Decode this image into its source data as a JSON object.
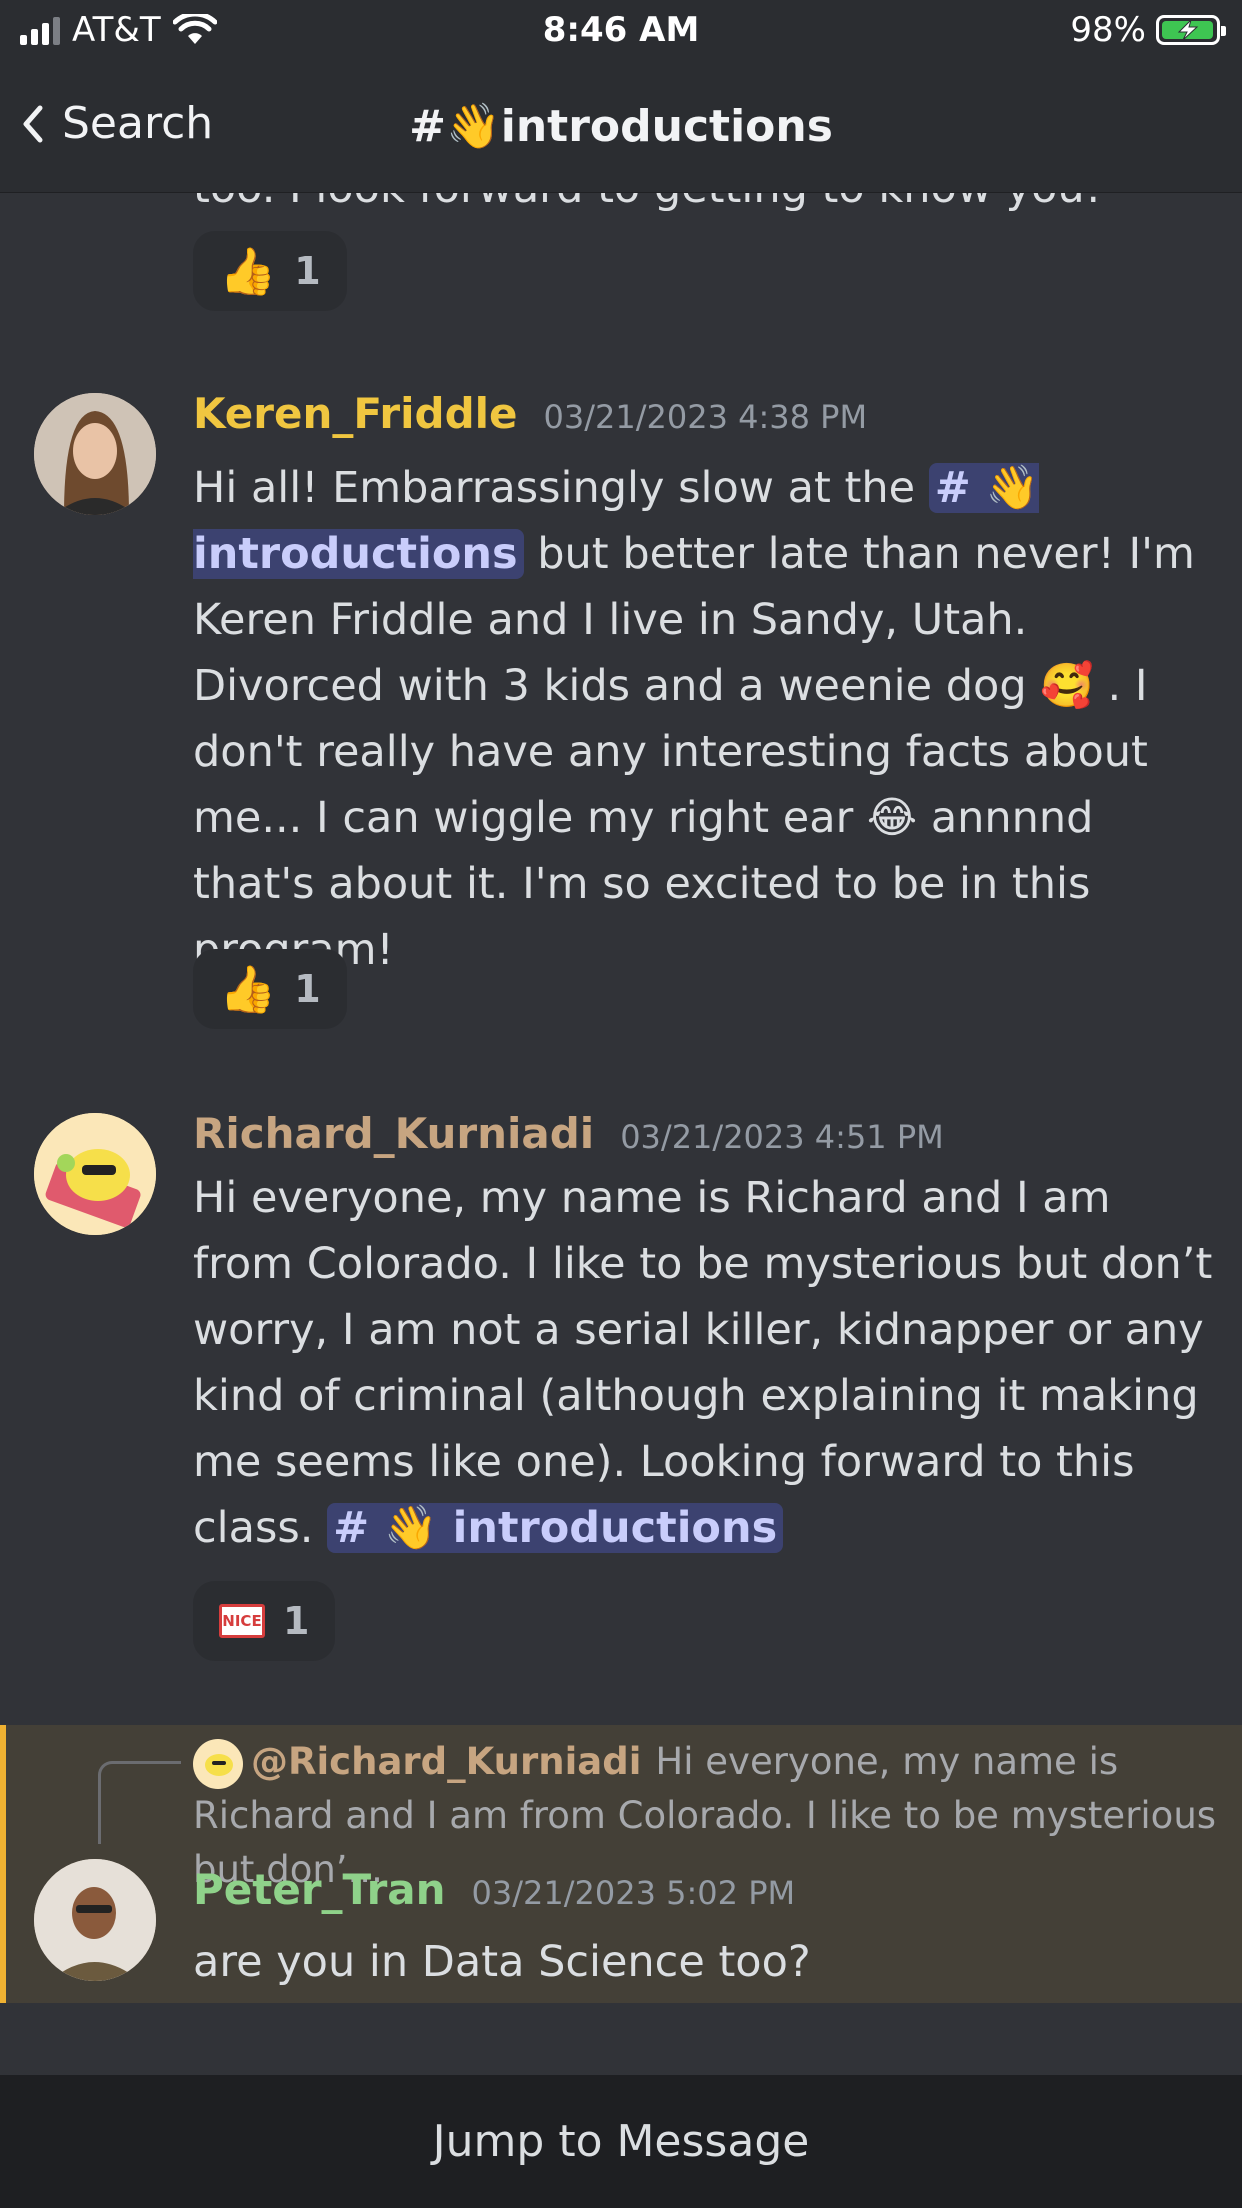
{
  "status_bar": {
    "carrier": "AT&T",
    "time": "8:46 AM",
    "battery": "98%"
  },
  "header": {
    "back_label": "Search",
    "channel": "#👋introductions"
  },
  "messages": [
    {
      "clipped_text": "too. I look forward to getting to know you!",
      "reaction": {
        "emoji": "👍",
        "count": "1"
      }
    },
    {
      "author": "Keren_Friddle",
      "author_color": "#f0c640",
      "timestamp": "03/21/2023 4:38 PM",
      "body": {
        "part1": "Hi all! Embarrassingly slow at the ",
        "mention": "# 👋 introductions",
        "part2": " but better late than never! I'm Keren Friddle and I live in Sandy, Utah. Divorced with 3 kids and a weenie dog 🥰 . I don't really have any interesting facts about me... I can wiggle my right ear 😂 annnnd that's about it. I'm so excited to be in this program!"
      },
      "reaction": {
        "emoji": "👍",
        "count": "1"
      }
    },
    {
      "author": "Richard_Kurniadi",
      "author_color": "#c7a581",
      "timestamp": "03/21/2023 4:51 PM",
      "body": {
        "part1": "Hi everyone, my name is Richard and I am from Colorado. I like to be mysterious but don’t worry, I am not a serial killer, kidnapper or any kind of criminal (although explaining it making me seems like one). Looking forward to this class. ",
        "mention": "# 👋 introductions"
      },
      "reaction": {
        "emoji": "NICE",
        "count": "1"
      }
    },
    {
      "reply_to": {
        "author": "@Richard_Kurniadi",
        "preview": "Hi everyone, my name is Richard and I am from Colorado. I like to be mysterious but don’..."
      },
      "author": "Peter_Tran",
      "author_color": "#8fd28a",
      "timestamp": "03/21/2023 5:02 PM",
      "body": {
        "part1": "are you in Data Science too?"
      }
    }
  ],
  "footer": {
    "jump_label": "Jump to Message"
  }
}
